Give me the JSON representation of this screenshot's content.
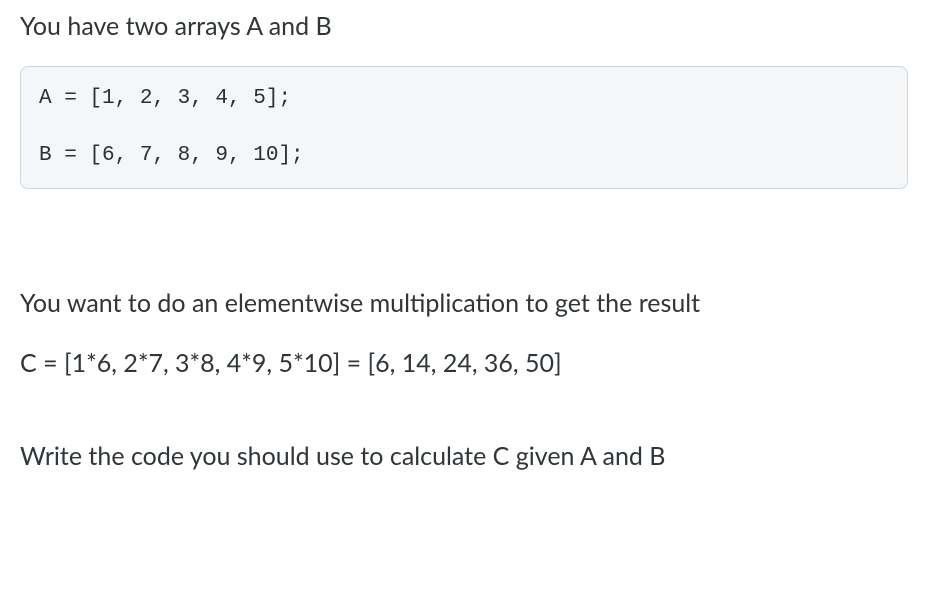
{
  "intro": "You have two arrays A and B",
  "code": {
    "line1": "A = [1, 2, 3, 4, 5];",
    "line2": "B = [6, 7, 8, 9, 10];"
  },
  "explain": "You want to do an elementwise multiplication to get the result",
  "result": "C = [1*6, 2*7, 3*8, 4*9, 5*10] = [6, 14, 24, 36, 50]",
  "prompt": "Write the code you should use to calculate C given A and B"
}
